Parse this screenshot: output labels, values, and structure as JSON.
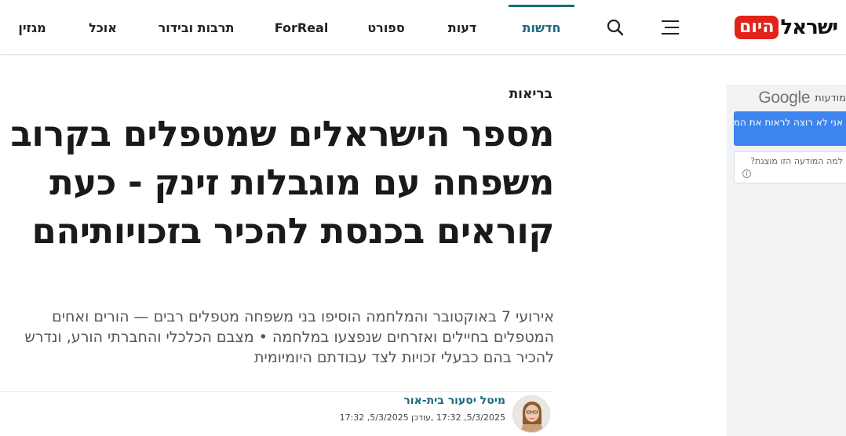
{
  "brand": {
    "logo_black": "ישראל",
    "logo_red": "היום"
  },
  "nav": {
    "items": [
      {
        "label": "חדשות",
        "active": true
      },
      {
        "label": "דעות"
      },
      {
        "label": "ספורט"
      },
      {
        "label": "ForReal"
      },
      {
        "label": "תרבות ובידור"
      },
      {
        "label": "אוכל"
      },
      {
        "label": "מגזין"
      }
    ],
    "icons": [
      "hamburger-menu-icon",
      "search-icon"
    ]
  },
  "article": {
    "category": "בריאות",
    "headline": "מספר הישראלים שמטפלים בקרוב משפחה עם מוגבלות זינק - כעת קוראים בכנסת להכיר בזכויותיהם",
    "subtitle": "אירועי 7 באוקטובר והמלחמה הוסיפו בני משפחה מטפלים רבים — הורים ואחים המטפלים בחיילים ואזרחים שנפצעו במלחמה • מצבם הכלכלי והחברתי הורע, ונדרש להכיר בהם כבעלי זכויות לצד עבודתם היומיומית",
    "author": "מיטל יסעור בית-אור",
    "date_line": "5/3/2025, 17:32 ,עודכן 5/3/2025, 17:32"
  },
  "ad": {
    "label": "מודעות",
    "google": "Google",
    "stop_button": "אני לא רוצה לראות את המודעה הזו",
    "why_label": "למה המודעה הזו מוצגת?",
    "info_glyph": "i"
  },
  "colors": {
    "accent": "#1a6b7d",
    "logo_red": "#e2231a",
    "ad_blue": "#3d84ee"
  }
}
